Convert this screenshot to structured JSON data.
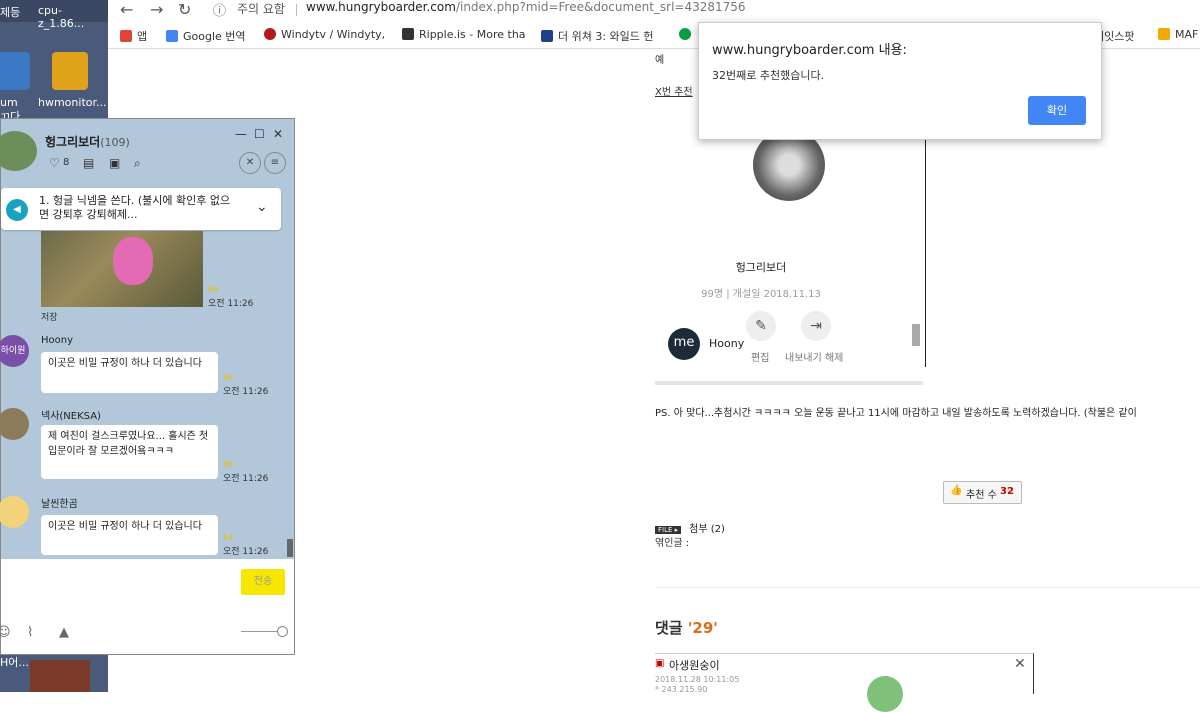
{
  "desktop": {
    "top_left": "제등",
    "top_right": "cpu-z_1.86...",
    "icons": [
      {
        "label": "um",
        "sub": "ㄲ다",
        "color": "#3a78c4",
        "name": "media-app-icon"
      },
      {
        "label": "hwmonitor...",
        "color": "#e0a21b",
        "name": "hwmonitor-icon"
      }
    ],
    "bottom_label": "H어..."
  },
  "browser": {
    "security_label": "주의 요함",
    "url_host": "www.hungryboarder.com",
    "url_query": "/index.php?mid=Free&document_srl=43281756",
    "bookmarks": [
      {
        "label": "앱",
        "color": "#e1443a"
      },
      {
        "label": "Google 번역",
        "color": "#4285f4"
      },
      {
        "label": "Windytv / Windyty, ",
        "color": "#b31b1b"
      },
      {
        "label": "Ripple.is - More tha",
        "color": "#333333"
      },
      {
        "label": "더 위쳐 3: 와일드 헌",
        "color": "#1f3f8c"
      },
      {
        "label": "",
        "color": "#0a9d45"
      },
      {
        "label": "케잇스팟",
        "color": "#555555"
      },
      {
        "label": "MAF",
        "color": "#f2a900"
      }
    ]
  },
  "page": {
    "cut_text_1": "예",
    "cut_text_2": "X번 추천",
    "community": {
      "name": "헝그리보더",
      "meta": "99명 | 개설일 2018.11.13",
      "edit_label": "편집",
      "export_label": "내보내기 해제"
    },
    "member": {
      "avatar_text": "me",
      "name": "Hoony"
    },
    "ps_text": "PS. 아 맞다...추첨시간 ㅋㅋㅋㅋ 오늘 운동 끝나고 11시에 마감하고 내일 발송하도록 노력하겠습니다. (착불은 같이",
    "vote_label": "추천 수",
    "vote_count": "32",
    "attach_badge": "FILE ▸",
    "attach_label": "첨부 (2)",
    "related_label": "엮인글 :",
    "comments_title": "댓글 ",
    "comments_count": "'29'",
    "comment_author": "아생원숭이",
    "comment_date": "2018.11.28 10:11:05",
    "comment_ip": "* 243.215.90"
  },
  "dialog": {
    "title": "www.hungryboarder.com 내용:",
    "message": "32번째로 추천했습니다.",
    "ok_label": "확인"
  },
  "chat": {
    "room_name": "헝그리보더",
    "member_count": "(109)",
    "likes": "8",
    "notice": "1. 헝글 닉넴을 쓴다. (불시에 확인후 없으면 강퇴후 강퇴해제...",
    "image_caption": "저장",
    "messages": [
      {
        "sender": "",
        "text": "",
        "unread": "86",
        "time": "오전 11:26"
      },
      {
        "sender": "Hoony",
        "avatar_text": "하이원",
        "text": "이곳은 비밀 규정이 하나 더 있습니다",
        "unread": "86",
        "time": "오전 11:26"
      },
      {
        "sender": "넥사(NEKSA)",
        "text": "제 여친이 걸스크루였나요... 홀시즌 첫 입문이라 잘 모르겠어욬ㅋㅋㅋ",
        "unread": "86",
        "time": "오전 11:26"
      },
      {
        "sender": "날씬한곰",
        "text": "이곳은 비밀 규정이 하나 더 있습니다",
        "unread": "84",
        "time": "오전 11:26"
      }
    ],
    "send_label": "전송"
  }
}
